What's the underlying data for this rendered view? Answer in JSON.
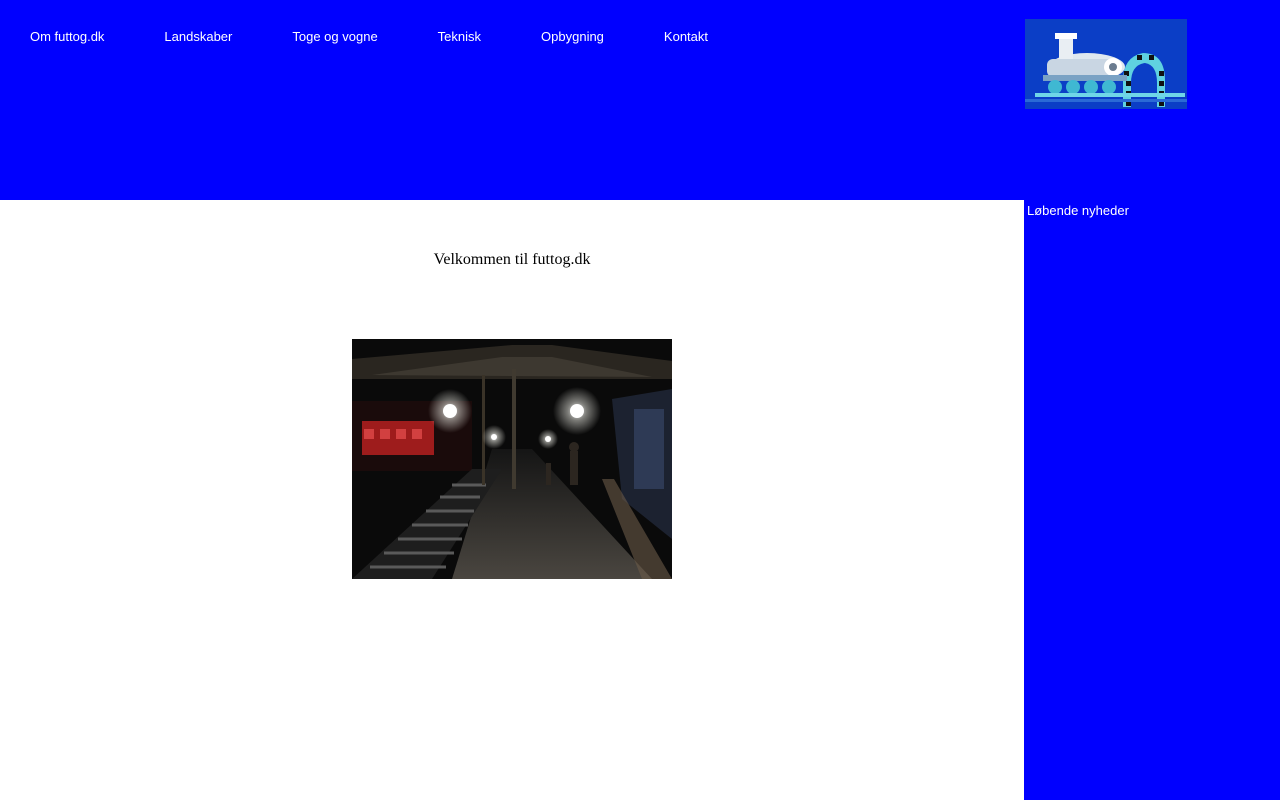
{
  "nav": {
    "items": [
      {
        "label": "Om futtog.dk"
      },
      {
        "label": "Landskaber"
      },
      {
        "label": "Toge og vogne"
      },
      {
        "label": "Teknisk"
      },
      {
        "label": "Opbygning"
      },
      {
        "label": "Kontakt"
      }
    ]
  },
  "header": {
    "logo_icon": "steam-locomotive-logo",
    "background_color": "#0000ff"
  },
  "main": {
    "welcome_text": "Velkommen til futtog.dk",
    "photo_icon": "train-station-platform-photo"
  },
  "sidebar": {
    "title": "Løbende nyheder"
  },
  "colors": {
    "header_bg": "#0000ff",
    "sidebar_bg": "#0000ff",
    "main_bg": "#ffffff",
    "nav_text": "#ffffff"
  }
}
